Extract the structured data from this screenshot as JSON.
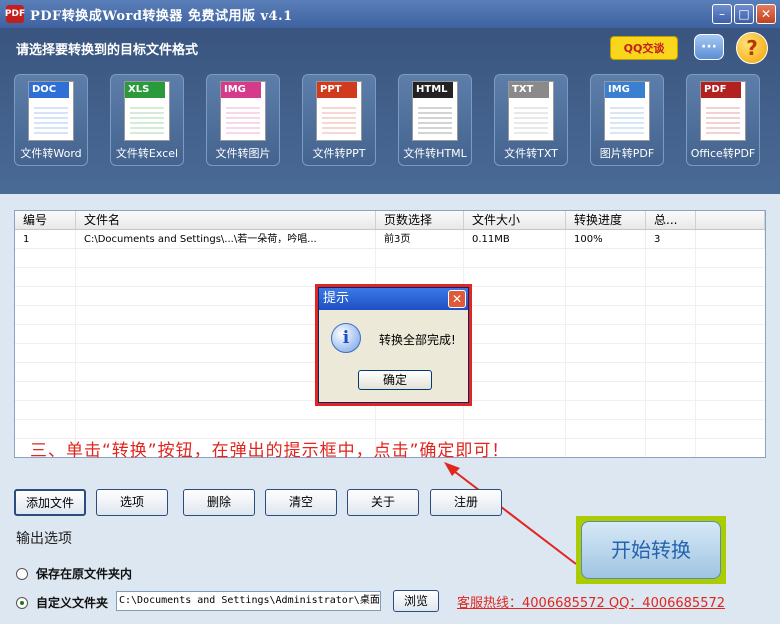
{
  "window": {
    "title": "PDF转换成Word转换器 免费试用版 v4.1",
    "app_icon_text": "PDF"
  },
  "header": {
    "title": "请选择要转换到的目标文件格式",
    "qq_button": "QQ交谈"
  },
  "tools": [
    {
      "tag": "DOC",
      "label": "文件转Word",
      "color": "#2f6fd6"
    },
    {
      "tag": "XLS",
      "label": "文件转Excel",
      "color": "#2a9a3a"
    },
    {
      "tag": "IMG",
      "label": "文件转图片",
      "color": "#d63a8a"
    },
    {
      "tag": "PPT",
      "label": "文件转PPT",
      "color": "#d23a1e"
    },
    {
      "tag": "HTML",
      "label": "文件转HTML",
      "color": "#222222"
    },
    {
      "tag": "TXT",
      "label": "文件转TXT",
      "color": "#8a8a8a"
    },
    {
      "tag": "IMG",
      "label": "图片转PDF",
      "color": "#3a7fd0"
    },
    {
      "tag": "PDF",
      "label": "Office转PDF",
      "color": "#b32020"
    }
  ],
  "table": {
    "headers": [
      "编号",
      "文件名",
      "页数选择",
      "文件大小",
      "转换进度",
      "总..."
    ],
    "rows": [
      [
        "1",
        "C:\\Documents and Settings\\...\\若一朵荷，吟唱...",
        "前3页",
        "0.11MB",
        "100%",
        "3"
      ]
    ]
  },
  "dialog": {
    "title": "提示",
    "message": "转换全部完成!",
    "ok": "确定",
    "icon": "i"
  },
  "instruction": "三、单击“转换”按钮，在弹出的提示框中，点击”确定即可！",
  "buttons": [
    "添加文件",
    "选项",
    "删除",
    "清空",
    "关于",
    "注册"
  ],
  "output": {
    "section_title": "输出选项",
    "option_same_folder": "保存在原文件夹内",
    "option_custom_folder": "自定义文件夹",
    "custom_path": "C:\\Documents and Settings\\Administrator\\桌面",
    "browse": "浏览"
  },
  "hotline": "客服热线：4006685572 QQ：4006685572",
  "start_button": "开始转换"
}
